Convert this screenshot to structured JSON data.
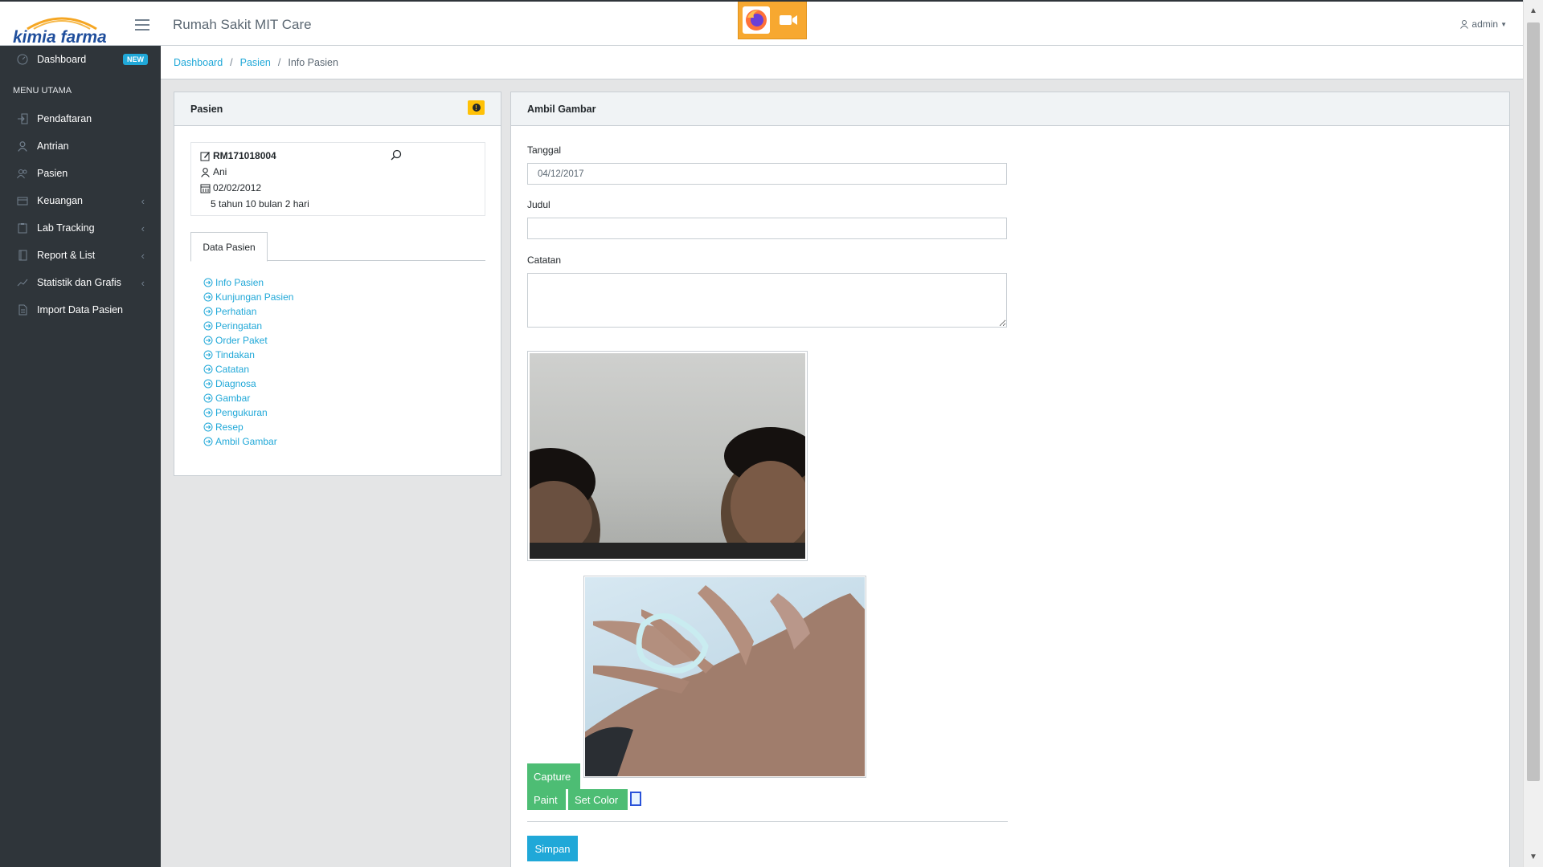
{
  "brand": {
    "logo_text": "kimia farma"
  },
  "header": {
    "app_title": "Rumah Sakit MIT Care",
    "user": "admin"
  },
  "sidebar": {
    "dashboard": {
      "label": "Dashboard",
      "badge": "NEW"
    },
    "section_title": "MENU UTAMA",
    "items": [
      {
        "label": "Pendaftaran",
        "icon": "login-icon",
        "has_caret": false
      },
      {
        "label": "Antrian",
        "icon": "user-icon",
        "has_caret": false
      },
      {
        "label": "Pasien",
        "icon": "users-icon",
        "has_caret": false
      },
      {
        "label": "Keuangan",
        "icon": "wallet-icon",
        "has_caret": true
      },
      {
        "label": "Lab Tracking",
        "icon": "clipboard-icon",
        "has_caret": true
      },
      {
        "label": "Report & List",
        "icon": "notebook-icon",
        "has_caret": true
      },
      {
        "label": "Statistik dan Grafis",
        "icon": "chart-icon",
        "has_caret": true
      },
      {
        "label": "Import Data Pasien",
        "icon": "document-icon",
        "has_caret": false
      }
    ]
  },
  "breadcrumb": {
    "items": [
      "Dashboard",
      "Pasien"
    ],
    "current": "Info Pasien"
  },
  "patient_card": {
    "title": "Pasien",
    "rm_number": "RM171018004",
    "name": "Ani",
    "dob": "02/02/2012",
    "age": "5 tahun 10 bulan 2 hari",
    "tab_label": "Data Pasien",
    "links": [
      "Info Pasien",
      "Kunjungan Pasien",
      "Perhatian",
      "Peringatan",
      "Order Paket",
      "Tindakan",
      "Catatan",
      "Diagnosa",
      "Gambar",
      "Pengukuran",
      "Resep",
      "Ambil Gambar"
    ]
  },
  "capture_card": {
    "title": "Ambil Gambar",
    "tanggal_label": "Tanggal",
    "tanggal_value": "04/12/2017",
    "judul_label": "Judul",
    "judul_value": "",
    "catatan_label": "Catatan",
    "catatan_value": "",
    "capture_button": "Capture",
    "paint_button": "Paint",
    "set_color_button": "Set Color",
    "save_button": "Simpan"
  },
  "colors": {
    "sidebar_bg": "#2f353a",
    "accent_blue": "#20a8d8",
    "accent_green": "#4dbd74",
    "warning": "#ffc107"
  }
}
